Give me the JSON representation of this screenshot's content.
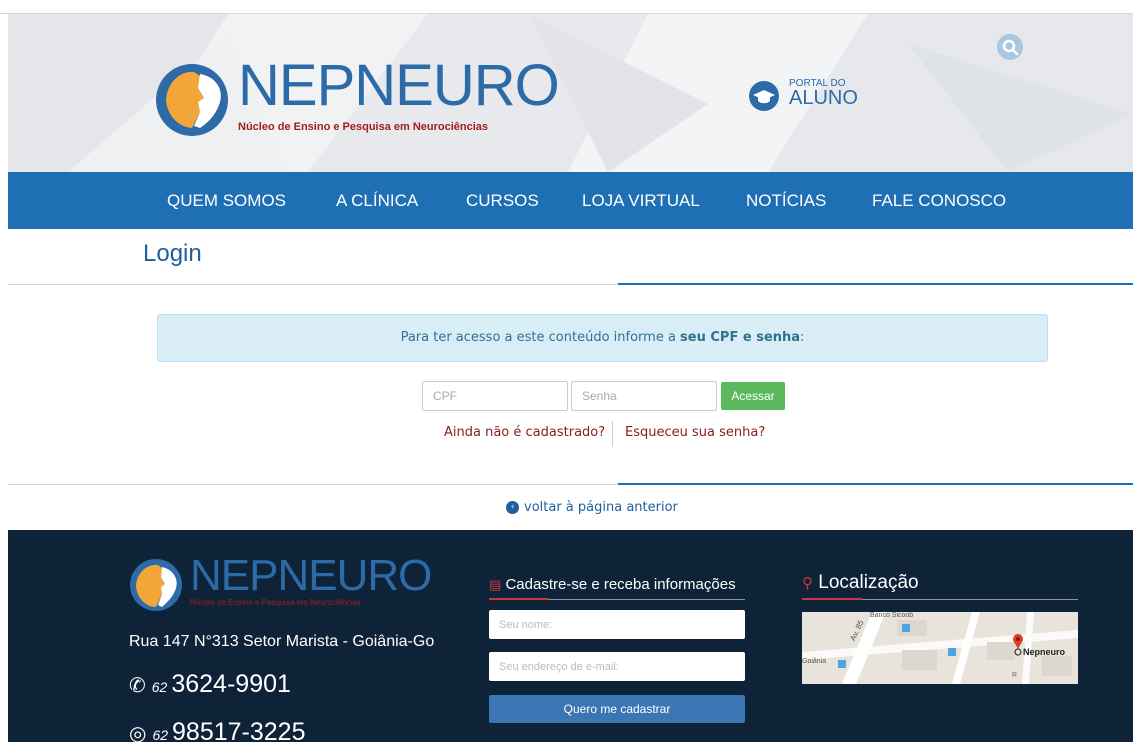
{
  "header": {
    "logo_text": "NEPNEURO",
    "logo_subtitle": "Núcleo de Ensino e Pesquisa em Neurociências",
    "portal_line1": "PORTAL DO",
    "portal_line2": "ALUNO"
  },
  "nav": {
    "items": [
      {
        "label": "QUEM SOMOS"
      },
      {
        "label": "A CLÍNICA"
      },
      {
        "label": "CURSOS"
      },
      {
        "label": "LOJA VIRTUAL"
      },
      {
        "label": "NOTÍCIAS"
      },
      {
        "label": "FALE CONOSCO"
      }
    ]
  },
  "page": {
    "title": "Login",
    "info_text_prefix": "Para ter acesso a este conteúdo informe a ",
    "info_text_bold": "seu CPF e senha",
    "info_text_suffix": ":",
    "cpf_placeholder": "CPF",
    "password_placeholder": "Senha",
    "submit_label": "Acessar",
    "register_link": "Ainda não é cadastrado?",
    "forgot_link": "Esqueceu sua senha?",
    "back_link": "voltar à página anterior"
  },
  "footer": {
    "logo_text": "NEPNEURO",
    "logo_subtitle": "Núcleo de Ensino e Pesquisa em Neurociências",
    "address": "Rua 147 N°313 Setor Marista - Goiânia-Go",
    "phone1_area": "62",
    "phone1_number": "3624-9901",
    "phone2_area": "62",
    "phone2_number": "98517-3225",
    "newsletter_title": "Cadastre-se e receba informações",
    "name_placeholder": "Seu nome:",
    "email_placeholder": "Seu endereço de e-mail:",
    "subscribe_label": "Quero me cadastrar",
    "location_title": "Localização",
    "map_labels": {
      "bank": "Banco Sicoob",
      "avenue": "Av. 85",
      "city": "Goiânia",
      "place": "Nepneuro",
      "street_marker": "R"
    }
  },
  "colors": {
    "brand_blue": "#1f6fb5",
    "brand_red": "#a01e1e",
    "success_green": "#5cb85c",
    "footer_bg": "#0f2338"
  }
}
